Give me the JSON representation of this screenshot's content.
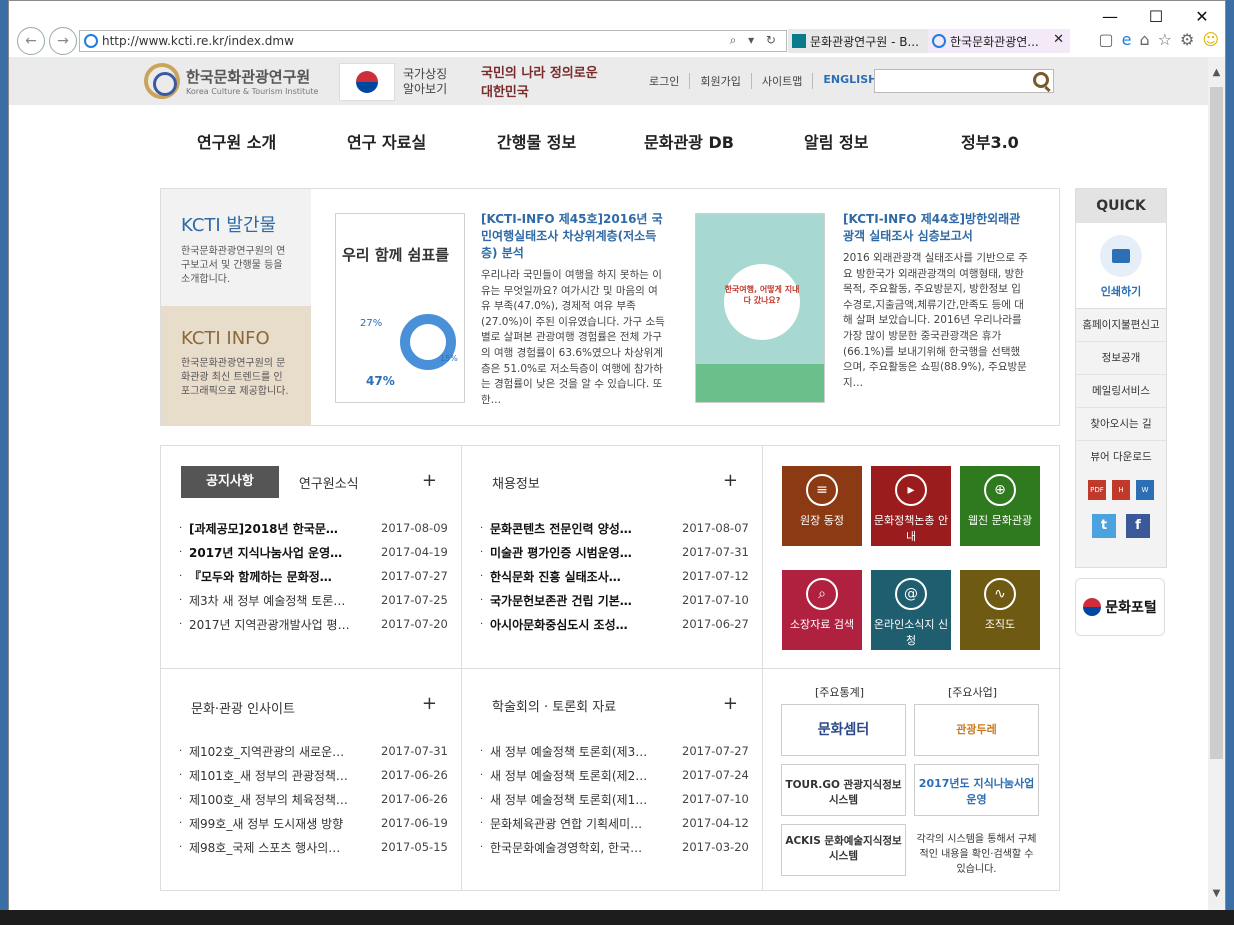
{
  "browser": {
    "url": "http://www.kcti.re.kr/index.dmw",
    "tabs": [
      {
        "label": "문화관광연구원 - B..."
      },
      {
        "label": "한국문화관광연..."
      }
    ],
    "win_buttons": {
      "minimize": "—",
      "maximize": "☐",
      "close": "✕"
    },
    "addr_tools": "⌕ ▾ ↻"
  },
  "header": {
    "logo_kor": "한국문화관광연구원",
    "logo_eng": "Korea Culture & Tourism Institute",
    "flag_text_1": "국가상징",
    "flag_text_2": "알아보기",
    "slogan": "국민의 나라 정의로운 대한민국",
    "links": [
      "로그인",
      "회원가입",
      "사이트맵",
      "ENGLISH"
    ]
  },
  "gnb": [
    "연구원 소개",
    "연구 자료실",
    "간행물 정보",
    "문화관광 DB",
    "알림 정보",
    "정부3.0"
  ],
  "publications": {
    "nav1": {
      "title": "KCTI 발간물",
      "desc": "한국문화관광연구원의 연구보고서 및 간행물 등을 소개합니다."
    },
    "nav2": {
      "title": "KCTI  INFO",
      "desc": "한국문화관광연구원의 문화관광 최신 트렌드를 인포그래픽으로 제공합니다."
    },
    "item1": {
      "title": "[KCTI-INFO 제45호]2016년 국민여행실태조사 차상위계층(저소득층) 분석",
      "desc": "우리나라 국민들이 여행을 하지 못하는 이유는 무엇일까요? 여가시간 및 마음의 여유 부족(47.0%), 경제적 여유 부족(27.0%)이 주된 이유였습니다. 가구 소득별로 살펴본 관광여행 경험률은 전체 가구의 여행 경험률이 63.6%였으나 차상위계층은 51.0%로 저소득층이 여행에 참가하는 경험률이 낮은 것을 알 수 있습니다. 또한…",
      "thumb_title": "우리 함께 쉼표를",
      "thumb_stats": [
        "27%",
        "15%",
        "47%"
      ]
    },
    "item2": {
      "title": "[KCTI-INFO 제44호]방한외래관광객 실태조사 심층보고서",
      "desc": "2016 외래관광객 실태조사를 기반으로 주요 방한국가 외래관광객의 여행형태, 방한목적, 주요활동, 주요방문지, 방한정보 입수경로,지출금액,체류기간,만족도 등에 대해 살펴 보았습니다. 2016년 우리나라를 가장 많이 방문한 중국관광객은 휴가(66.1%)를 보내기위해 한국행을 선택했으며, 주요활동은 쇼핑(88.9%), 주요방문지…",
      "thumb_title": "한국여행, 어떻게 지내다 갔나요?"
    }
  },
  "boards": {
    "notice": {
      "tab_on": "공지사항",
      "tab_off": "연구원소식",
      "items": [
        {
          "text": "[과제공모]2018년 한국문…",
          "date": "2017-08-09",
          "bold": true
        },
        {
          "text": "2017년 지식나눔사업 운영…",
          "date": "2017-04-19",
          "bold": true
        },
        {
          "text": "『모두와 함께하는 문화정…",
          "date": "2017-07-27",
          "bold": true
        },
        {
          "text": "제3차 새 정부 예술정책 토론…",
          "date": "2017-07-25",
          "bold": false
        },
        {
          "text": "2017년 지역관광개발사업 평…",
          "date": "2017-07-20",
          "bold": false
        }
      ]
    },
    "recruit": {
      "title": "채용정보",
      "items": [
        {
          "text": "문화콘텐츠 전문인력 양성…",
          "date": "2017-08-07",
          "bold": true
        },
        {
          "text": "미술관 평가인증 시범운영…",
          "date": "2017-07-31",
          "bold": true
        },
        {
          "text": "한식문화 진흥 실태조사…",
          "date": "2017-07-12",
          "bold": true
        },
        {
          "text": "국가문헌보존관 건립 기본…",
          "date": "2017-07-10",
          "bold": true
        },
        {
          "text": "아시아문화중심도시 조성…",
          "date": "2017-06-27",
          "bold": true
        }
      ]
    },
    "insight": {
      "title": "문화·관광 인사이트",
      "items": [
        {
          "text": "제102호_지역관광의 새로운…",
          "date": "2017-07-31"
        },
        {
          "text": "제101호_새 정부의 관광정책…",
          "date": "2017-06-26"
        },
        {
          "text": "제100호_새 정부의 체육정책…",
          "date": "2017-06-26"
        },
        {
          "text": "제99호_새 정부 도시재생 방향",
          "date": "2017-06-19"
        },
        {
          "text": "제98호_국제 스포츠 행사의…",
          "date": "2017-05-15"
        }
      ]
    },
    "seminar": {
      "title": "학술회의 · 토론회 자료",
      "items": [
        {
          "text": "새 정부 예술정책 토론회(제3…",
          "date": "2017-07-27"
        },
        {
          "text": "새 정부 예술정책 토론회(제2…",
          "date": "2017-07-24"
        },
        {
          "text": "새 정부 예술정책 토론회(제1…",
          "date": "2017-07-10"
        },
        {
          "text": "문화체육관광 연합 기획세미…",
          "date": "2017-04-12"
        },
        {
          "text": "한국문화예술경영학회, 한국…",
          "date": "2017-03-20"
        }
      ]
    }
  },
  "tiles": [
    {
      "label": "원장 동정",
      "color": "#8b3a14",
      "icon": "≡"
    },
    {
      "label": "문화정책논총 안내",
      "color": "#9b1c1c",
      "icon": "▸"
    },
    {
      "label": "웹진 문화관광",
      "color": "#2f7a1f",
      "icon": "⊕"
    },
    {
      "label": "소장자료 검색",
      "color": "#b0203f",
      "icon": "⌕"
    },
    {
      "label": "온라인소식지 신청",
      "color": "#1f5e6e",
      "icon": "@"
    },
    {
      "label": "조직도",
      "color": "#6e5a12",
      "icon": "∿"
    }
  ],
  "banners": {
    "stat_label": "[주요통계]",
    "biz_label": "[주요사업]",
    "items": [
      "문화셈터",
      "관광두레",
      "TOUR.GO 관광지식정보시스템",
      "2017년도 지식나눔사업 운영",
      "ACKIS 문화예술지식정보시스템",
      "각각의 시스템을 통해서 구체적인 내용을 확인·검색할 수 있습니다."
    ]
  },
  "quick": {
    "title": "QUICK",
    "print": "인쇄하기",
    "links": [
      "홈페이지불편신고",
      "정보공개",
      "메일링서비스",
      "찾아오시는 길",
      "뷰어 다운로드"
    ],
    "docs": [
      "PDF",
      "H",
      "W"
    ],
    "sns": [
      "t",
      "f"
    ]
  },
  "portal": "문화포털"
}
